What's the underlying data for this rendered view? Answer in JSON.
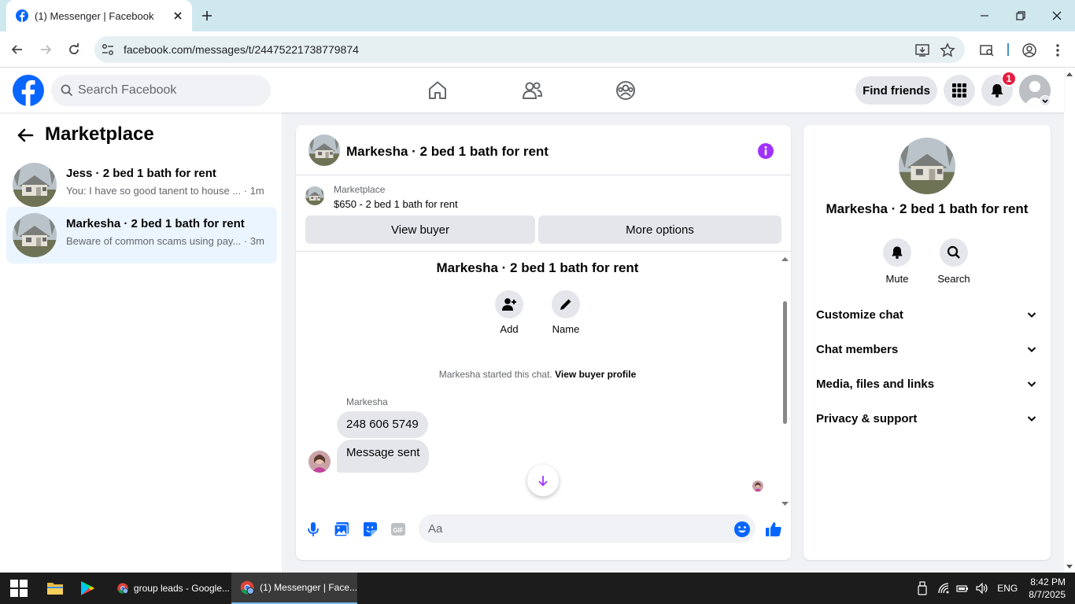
{
  "browser": {
    "tab_title": "(1) Messenger | Facebook",
    "url": "facebook.com/messages/t/24475221738779874"
  },
  "header": {
    "search_placeholder": "Search Facebook",
    "find_friends_label": "Find friends",
    "notification_count": "1"
  },
  "sidebar": {
    "title": "Marketplace",
    "conversations": [
      {
        "name": "Jess · 2 bed 1 bath for rent",
        "preview": "You: I have so good tanent to house ...",
        "time": "· 1m"
      },
      {
        "name": "Markesha · 2 bed 1 bath for rent",
        "preview": "Beware of common scams using pay...",
        "time": "· 3m"
      }
    ]
  },
  "chat": {
    "title": "Markesha · 2 bed 1 bath for rent",
    "listing_source": "Marketplace",
    "listing_price": "$650 - 2 bed 1 bath for rent",
    "view_buyer_label": "View buyer",
    "more_options_label": "More options",
    "chat_name": "Markesha · 2 bed 1 bath for rent",
    "add_label": "Add",
    "name_label": "Name",
    "started_text": "Markesha started this chat.",
    "view_profile_label": "View buyer profile",
    "sender_name": "Markesha",
    "messages": [
      "248 606 5749",
      "Message sent"
    ],
    "input_placeholder": "Aa"
  },
  "details": {
    "title": "Markesha · 2 bed 1 bath for rent",
    "mute_label": "Mute",
    "search_label": "Search",
    "sections": [
      "Customize chat",
      "Chat members",
      "Media, files and links",
      "Privacy & support"
    ]
  },
  "taskbar": {
    "apps": [
      "group leads - Google...",
      "(1) Messenger | Face..."
    ],
    "language": "ENG",
    "time": "8:42 PM",
    "date": "8/7/2025"
  },
  "colors": {
    "facebook_blue": "#0866ff",
    "messenger_purple": "#a033ff",
    "active_conversation": "#ebf5ff"
  }
}
